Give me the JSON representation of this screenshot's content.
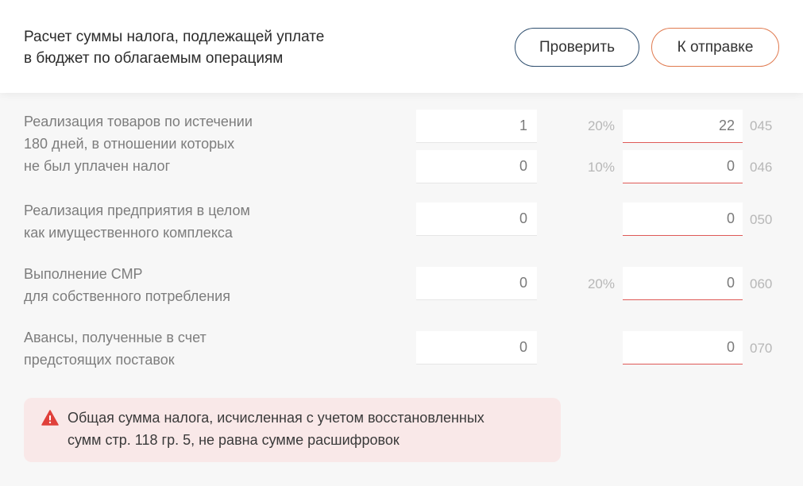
{
  "header": {
    "title": "Расчет суммы налога, подлежащей уплате\nв бюджет по облагаемым операциям",
    "check_button": "Проверить",
    "send_button": "К отправке"
  },
  "rows": [
    {
      "label": "Реализация товаров по истечении\n180 дней, в отношении которых\nне был уплачен налог",
      "lines": [
        {
          "base": "1",
          "rate": "20%",
          "tax": "22",
          "code": "045"
        },
        {
          "base": "0",
          "rate": "10%",
          "tax": "0",
          "code": "046"
        }
      ]
    },
    {
      "label": "Реализация предприятия в целом\nкак имущественного комплекса",
      "lines": [
        {
          "base": "0",
          "rate": "",
          "tax": "0",
          "code": "050"
        }
      ]
    },
    {
      "label": "Выполнение СМР\nдля собственного потребления",
      "lines": [
        {
          "base": "0",
          "rate": "20%",
          "tax": "0",
          "code": "060"
        }
      ]
    },
    {
      "label": "Авансы, полученные в счет\nпредстоящих поставок",
      "lines": [
        {
          "base": "0",
          "rate": "",
          "tax": "0",
          "code": "070"
        }
      ]
    }
  ],
  "alert": {
    "icon": "warning-icon",
    "text": "Общая сумма налога, исчисленная с учетом восстановленных\nсумм стр. 118 гр. 5, не равна сумме расшифровок"
  },
  "colors": {
    "error_underline": "#df5a57",
    "check_border": "#2e4e6e",
    "send_border": "#e07a4f",
    "alert_bg": "#f9e8e8",
    "warning_icon": "#e0403b"
  }
}
